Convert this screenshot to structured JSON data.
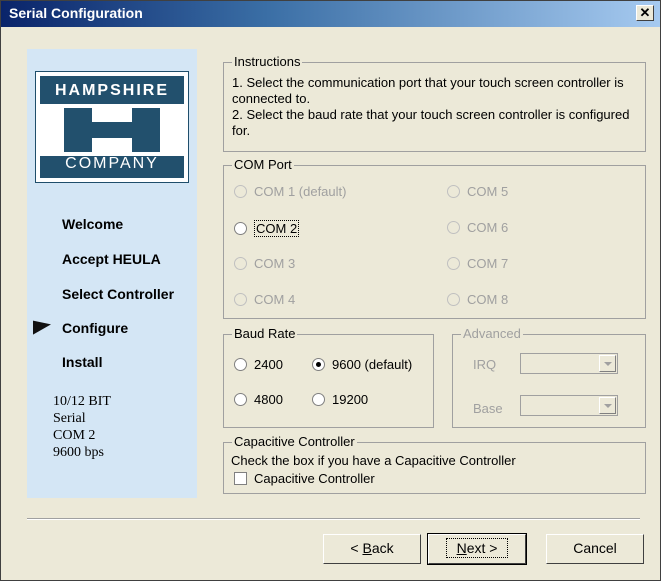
{
  "window": {
    "title": "Serial Configuration",
    "close_glyph": "✕"
  },
  "logo": {
    "top": "HAMPSHIRE",
    "bottom": "COMPANY"
  },
  "steps": [
    "Welcome",
    "Accept HEULA",
    "Select Controller",
    "Configure",
    "Install"
  ],
  "current_step": "Configure",
  "summary": [
    "10/12 BIT",
    "Serial",
    "COM 2",
    "9600 bps"
  ],
  "instructions": {
    "label": "Instructions",
    "line1": "1. Select the communication port that your touch screen controller is connected to.",
    "line2": "2. Select the baud rate that your touch screen controller is configured for."
  },
  "com_port": {
    "label": "COM Port",
    "options": [
      "COM 1 (default)",
      "COM 2",
      "COM 3",
      "COM 4",
      "COM 5",
      "COM 6",
      "COM 7",
      "COM 8"
    ],
    "selected": "COM 2"
  },
  "baud_rate": {
    "label": "Baud Rate",
    "options": [
      "2400",
      "9600 (default)",
      "4800",
      "19200"
    ],
    "selected": "9600 (default)"
  },
  "advanced": {
    "label": "Advanced",
    "irq_label": "IRQ",
    "base_label": "Base",
    "irq_value": "",
    "base_value": ""
  },
  "capacitive": {
    "label": "Capacitive Controller",
    "text": "Check the box if you have a Capacitive Controller",
    "checkbox_label": "Capacitive Controller",
    "checked": false
  },
  "buttons": {
    "back_prefix": "< ",
    "back_key": "B",
    "back_rest": "ack",
    "next_key": "N",
    "next_rest": "ext >",
    "cancel": "Cancel"
  }
}
